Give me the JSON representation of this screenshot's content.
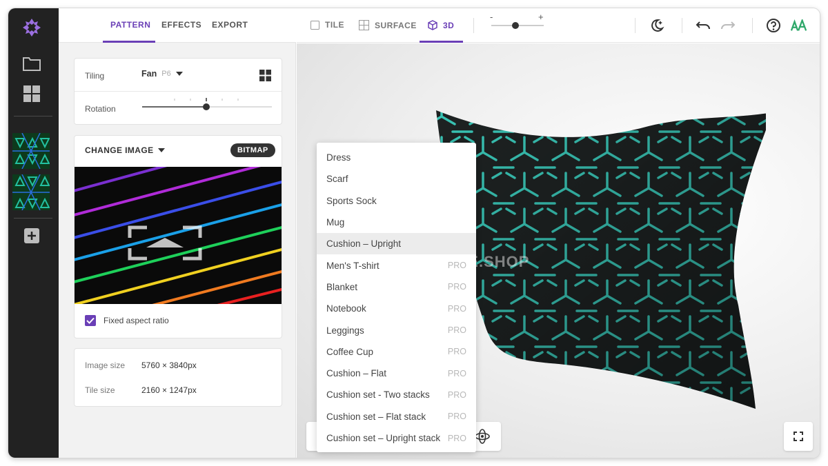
{
  "panel_tabs": [
    "PATTERN",
    "EFFECTS",
    "EXPORT"
  ],
  "tiling": {
    "label": "Tiling",
    "value": "Fan",
    "sub": "P6"
  },
  "rotation": {
    "label": "Rotation"
  },
  "image_card": {
    "change_label": "CHANGE IMAGE",
    "badge": "BITMAP",
    "checkbox_label": "Fixed aspect ratio"
  },
  "info": {
    "image_size_label": "Image size",
    "image_size": "5760 × 3840px",
    "tile_size_label": "Tile size",
    "tile_size": "2160 × 1247px"
  },
  "top_tabs": [
    "TILE",
    "SURFACE",
    "3D"
  ],
  "zoom": {
    "minus": "-",
    "plus": "+"
  },
  "menu": {
    "items": [
      {
        "label": "Dress",
        "pro": ""
      },
      {
        "label": "Scarf",
        "pro": ""
      },
      {
        "label": "Sports Sock",
        "pro": ""
      },
      {
        "label": "Mug",
        "pro": ""
      },
      {
        "label": "Cushion – Upright",
        "pro": ""
      },
      {
        "label": "Men's T-shirt",
        "pro": "PRO"
      },
      {
        "label": "Blanket",
        "pro": "PRO"
      },
      {
        "label": "Notebook",
        "pro": "PRO"
      },
      {
        "label": "Leggings",
        "pro": "PRO"
      },
      {
        "label": "Coffee Cup",
        "pro": "PRO"
      },
      {
        "label": "Cushion – Flat",
        "pro": "PRO"
      },
      {
        "label": "Cushion set - Two stacks",
        "pro": "PRO"
      },
      {
        "label": "Cushion set – Flat stack",
        "pro": "PRO"
      },
      {
        "label": "Cushion set – Upright stack",
        "pro": "PRO"
      }
    ]
  },
  "watermark": "© THESOFTWARE.SHOP",
  "colors": {
    "accent": "#6a3fb6",
    "rail": "#222222"
  }
}
